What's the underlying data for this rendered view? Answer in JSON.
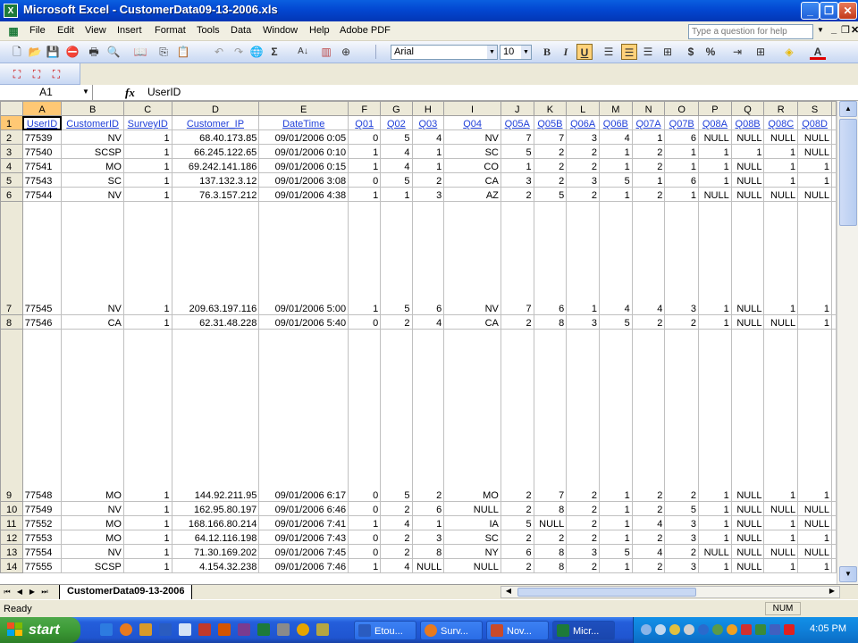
{
  "window": {
    "title": "Microsoft Excel - CustomerData09-13-2006.xls",
    "app_icon": "excel-icon",
    "buttons": [
      "minimize",
      "maximize",
      "close"
    ]
  },
  "menu": {
    "items": [
      "File",
      "Edit",
      "View",
      "Insert",
      "Format",
      "Tools",
      "Data",
      "Window",
      "Help",
      "Adobe PDF"
    ],
    "help_placeholder": "Type a question for help"
  },
  "toolbar": {
    "font_name": "Arial",
    "font_size": "10",
    "sum_symbol": "Σ",
    "currency_symbol": "$",
    "percent_symbol": "%",
    "bold_label": "B",
    "italic_label": "I",
    "underline_label": "U",
    "font_color_label": "A"
  },
  "formula_bar": {
    "name_box": "A1",
    "fx_label": "fx",
    "value": "UserID"
  },
  "sheet": {
    "columns": [
      "A",
      "B",
      "C",
      "D",
      "E",
      "F",
      "G",
      "H",
      "I",
      "J",
      "K",
      "L",
      "M",
      "N",
      "O",
      "P",
      "Q",
      "R",
      "S"
    ],
    "selected_column": "A",
    "rows": [
      {
        "n": "1",
        "cells": [
          "UserID",
          "CustomerID",
          "SurveyID",
          "Customer_IP",
          "DateTime",
          "Q01",
          "Q02",
          "Q03",
          "Q04",
          "Q05A",
          "Q05B",
          "Q06A",
          "Q06B",
          "Q07A",
          "Q07B",
          "Q08A",
          "Q08B",
          "Q08C",
          "Q08D"
        ]
      },
      {
        "n": "2",
        "cells": [
          "77539",
          "NV",
          "1",
          "68.40.173.85",
          "09/01/2006 0:05",
          "0",
          "5",
          "4",
          "NV",
          "7",
          "7",
          "3",
          "4",
          "1",
          "6",
          "NULL",
          "NULL",
          "NULL",
          "NULL"
        ]
      },
      {
        "n": "3",
        "cells": [
          "77540",
          "SCSP",
          "1",
          "66.245.122.65",
          "09/01/2006 0:10",
          "1",
          "4",
          "1",
          "SC",
          "5",
          "2",
          "2",
          "1",
          "2",
          "1",
          "1",
          "1",
          "1",
          "NULL"
        ]
      },
      {
        "n": "4",
        "cells": [
          "77541",
          "MO",
          "1",
          "69.242.141.186",
          "09/01/2006 0:15",
          "1",
          "4",
          "1",
          "CO",
          "1",
          "2",
          "2",
          "1",
          "2",
          "1",
          "1",
          "NULL",
          "1",
          "1"
        ]
      },
      {
        "n": "5",
        "cells": [
          "77543",
          "SC",
          "1",
          "137.132.3.12",
          "09/01/2006 3:08",
          "0",
          "5",
          "2",
          "CA",
          "3",
          "2",
          "3",
          "5",
          "1",
          "6",
          "1",
          "NULL",
          "1",
          "1"
        ]
      },
      {
        "n": "6",
        "cells": [
          "77544",
          "NV",
          "1",
          "76.3.157.212",
          "09/01/2006 4:38",
          "1",
          "1",
          "3",
          "AZ",
          "2",
          "5",
          "2",
          "1",
          "2",
          "1",
          "NULL",
          "NULL",
          "NULL",
          "NULL"
        ]
      },
      {
        "n": "7",
        "cells": [
          "77545",
          "NV",
          "1",
          "209.63.197.116",
          "09/01/2006 5:00",
          "1",
          "5",
          "6",
          "NV",
          "7",
          "6",
          "1",
          "4",
          "4",
          "3",
          "1",
          "NULL",
          "1",
          "1"
        ]
      },
      {
        "n": "8",
        "cells": [
          "77546",
          "CA",
          "1",
          "62.31.48.228",
          "09/01/2006 5:40",
          "0",
          "2",
          "4",
          "CA",
          "2",
          "8",
          "3",
          "5",
          "2",
          "2",
          "1",
          "NULL",
          "NULL",
          "1"
        ]
      },
      {
        "n": "9",
        "cells": [
          "77548",
          "MO",
          "1",
          "144.92.211.95",
          "09/01/2006 6:17",
          "0",
          "5",
          "2",
          "MO",
          "2",
          "7",
          "2",
          "1",
          "2",
          "2",
          "1",
          "NULL",
          "1",
          "1"
        ]
      },
      {
        "n": "10",
        "cells": [
          "77549",
          "NV",
          "1",
          "162.95.80.197",
          "09/01/2006 6:46",
          "0",
          "2",
          "6",
          "NULL",
          "2",
          "8",
          "2",
          "1",
          "2",
          "5",
          "1",
          "NULL",
          "NULL",
          "NULL"
        ]
      },
      {
        "n": "11",
        "cells": [
          "77552",
          "MO",
          "1",
          "168.166.80.214",
          "09/01/2006 7:41",
          "1",
          "4",
          "1",
          "IA",
          "5",
          "NULL",
          "2",
          "1",
          "4",
          "3",
          "1",
          "NULL",
          "1",
          "NULL"
        ]
      },
      {
        "n": "12",
        "cells": [
          "77553",
          "MO",
          "1",
          "64.12.116.198",
          "09/01/2006 7:43",
          "0",
          "2",
          "3",
          "SC",
          "2",
          "2",
          "2",
          "1",
          "2",
          "3",
          "1",
          "NULL",
          "1",
          "1"
        ]
      },
      {
        "n": "13",
        "cells": [
          "77554",
          "NV",
          "1",
          "71.30.169.202",
          "09/01/2006 7:45",
          "0",
          "2",
          "8",
          "NY",
          "6",
          "8",
          "3",
          "5",
          "4",
          "2",
          "NULL",
          "NULL",
          "NULL",
          "NULL"
        ]
      },
      {
        "n": "14",
        "cells": [
          "77555",
          "SCSP",
          "1",
          "4.154.32.238",
          "09/01/2006 7:46",
          "1",
          "4",
          "NULL",
          "NULL",
          "2",
          "8",
          "2",
          "1",
          "2",
          "3",
          "1",
          "NULL",
          "1",
          "1"
        ]
      }
    ],
    "tab_name": "CustomerData09-13-2006"
  },
  "status": {
    "text": "Ready",
    "num": "NUM"
  },
  "taskbar": {
    "start_label": "start",
    "buttons": [
      {
        "label": "Etou...",
        "icon": "word-icon",
        "active": false
      },
      {
        "label": "Surv...",
        "icon": "firefox-icon",
        "active": false
      },
      {
        "label": "Nov...",
        "icon": "browser-icon",
        "active": false
      },
      {
        "label": "Micr...",
        "icon": "excel-icon",
        "active": true
      }
    ],
    "clock": "4:05 PM"
  },
  "colors": {
    "title_blue": "#0347d1",
    "header_link": "#1f3fd8",
    "selected_header": "#ffc874",
    "start_green": "#3c9a36"
  }
}
